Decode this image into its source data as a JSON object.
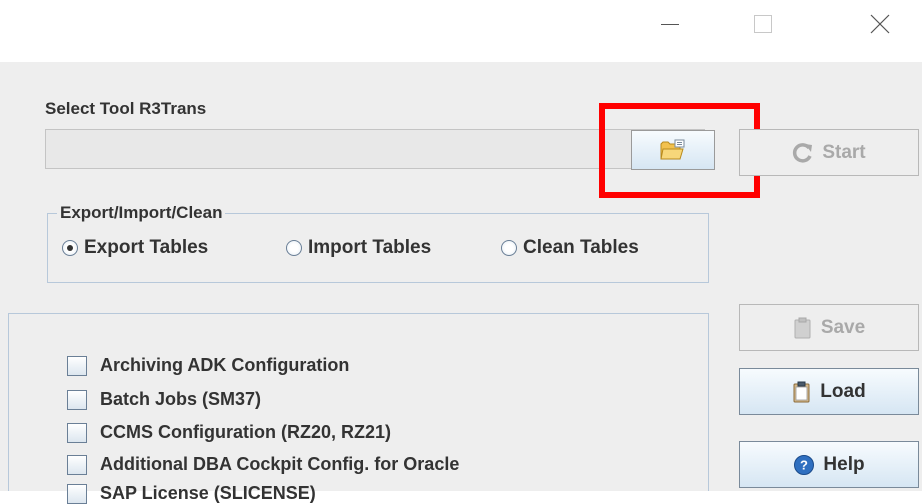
{
  "window_controls": {
    "minimize_icon": "minimize-icon",
    "maximize_icon": "maximize-icon",
    "close_icon": "close-icon"
  },
  "tool_select": {
    "label": "Select Tool R3Trans",
    "path_value": "",
    "browse_icon": "folder-open-icon"
  },
  "start_button": {
    "label": "Start",
    "icon": "refresh-icon",
    "enabled": false
  },
  "mode_group": {
    "title": "Export/Import/Clean",
    "options": [
      {
        "label": "Export Tables",
        "checked": true
      },
      {
        "label": "Import Tables",
        "checked": false
      },
      {
        "label": "Clean Tables",
        "checked": false
      }
    ]
  },
  "table_list": {
    "items": [
      {
        "label": "Archiving ADK Configuration",
        "checked": false
      },
      {
        "label": "Batch Jobs (SM37)",
        "checked": false
      },
      {
        "label": "CCMS Configuration (RZ20, RZ21)",
        "checked": false
      },
      {
        "label": "Additional DBA Cockpit Config. for Oracle",
        "checked": false
      },
      {
        "label": "SAP License (SLICENSE)",
        "checked": false
      }
    ]
  },
  "side_buttons": {
    "save": {
      "label": "Save",
      "icon": "clipboard-icon",
      "enabled": false
    },
    "load": {
      "label": "Load",
      "icon": "clipboard-icon",
      "enabled": true
    },
    "help": {
      "label": "Help",
      "icon": "help-icon",
      "enabled": true
    }
  },
  "colors": {
    "highlight": "#ff0000",
    "panel_background": "#eeeeee",
    "button_gradient_top": "#f7fbfe",
    "button_gradient_bottom": "#d6e6f3"
  }
}
